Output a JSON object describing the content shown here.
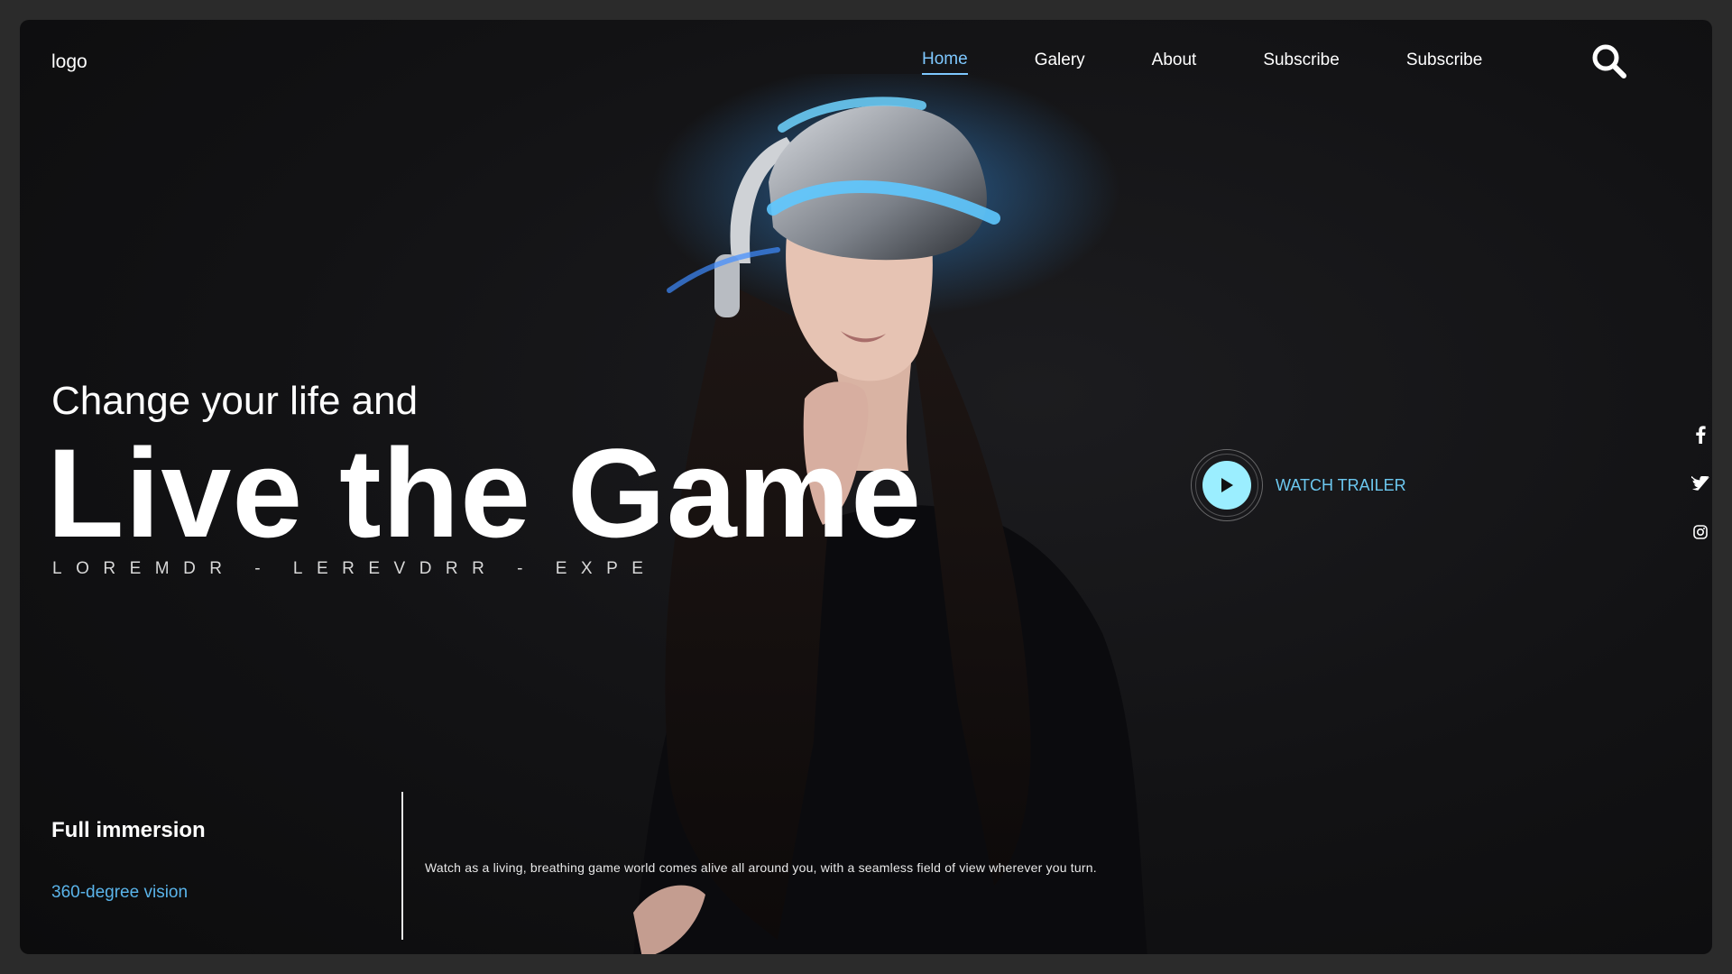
{
  "brand": {
    "logo_text": "logo"
  },
  "nav": {
    "items": [
      {
        "label": "Home",
        "active": true
      },
      {
        "label": "Galery",
        "active": false
      },
      {
        "label": "About",
        "active": false
      },
      {
        "label": "Subscribe",
        "active": false
      },
      {
        "label": "Subscribe",
        "active": false
      }
    ],
    "search_icon": "search-icon"
  },
  "hero": {
    "subtitle": "Change your life and",
    "headline": "Live the Game",
    "tagline": "LOREMDR - LEREVDRR - EXPE"
  },
  "trailer": {
    "label": "WATCH TRAILER",
    "icon": "play-icon"
  },
  "social": [
    {
      "icon": "facebook-icon"
    },
    {
      "icon": "twitter-icon"
    },
    {
      "icon": "instagram-icon"
    }
  ],
  "feature": {
    "title": "Full immersion",
    "subtitle": "360-degree vision",
    "description": "Watch as a living, breathing game world comes alive all around you, with a seamless field of view wherever you turn."
  },
  "colors": {
    "accent": "#7ec8ff",
    "play_button": "#9beeff",
    "feature_sub": "#5ab4ea",
    "background": "#121214"
  }
}
